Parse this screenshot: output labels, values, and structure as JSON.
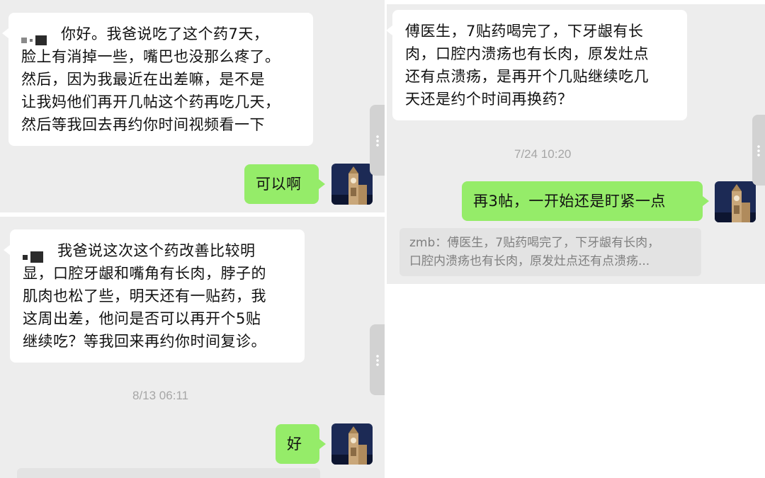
{
  "left": {
    "msg1": {
      "lines": [
        "你好。我爸说吃了这个药7天，",
        "脸上有消掉一些，嘴巴也没那么疼了。",
        "然后，因为我最近在出差嘛，是不是",
        "让我妈他们再开几帖这个药再吃几天，",
        "然后等我回去再约你时间视频看一下"
      ]
    },
    "reply1": "可以啊",
    "msg2": {
      "lines": [
        "我爸说这次这个药改善比较明",
        "显，口腔牙龈和嘴角有长肉，脖子的",
        "肌肉也松了些，明天还有一贴药，我",
        "这周出差，他问是否可以再开个5贴",
        "继续吃？等我回来再约你时间复诊。"
      ]
    },
    "timestamp": "8/13 06:11",
    "reply2": "好"
  },
  "right": {
    "msg1": {
      "lines": [
        "傅医生，7贴药喝完了，下牙龈有长",
        "肉，口腔内溃疡也有长肉，原发灶点",
        "还有点溃疡，是再开个几贴继续吃几",
        "天还是约个时间再换药？"
      ]
    },
    "timestamp": "7/24 10:20",
    "reply1": "再3帖，一开始还是盯紧一点",
    "quote": {
      "lines": [
        "zmb：傅医生，7贴药喝完了，下牙龈有长肉，",
        "口腔内溃疡也有长肉，原发灶点还有点溃疡..."
      ]
    }
  },
  "icons": {
    "avatar": "clock-tower-avatar",
    "scroll": "more-dots-icon",
    "mask": "pixelated-name-mask"
  },
  "colors": {
    "chat_bg": "#ededed",
    "incoming_bubble": "#ffffff",
    "outgoing_bubble": "#95ec69",
    "timestamp": "#a6a6a6"
  }
}
